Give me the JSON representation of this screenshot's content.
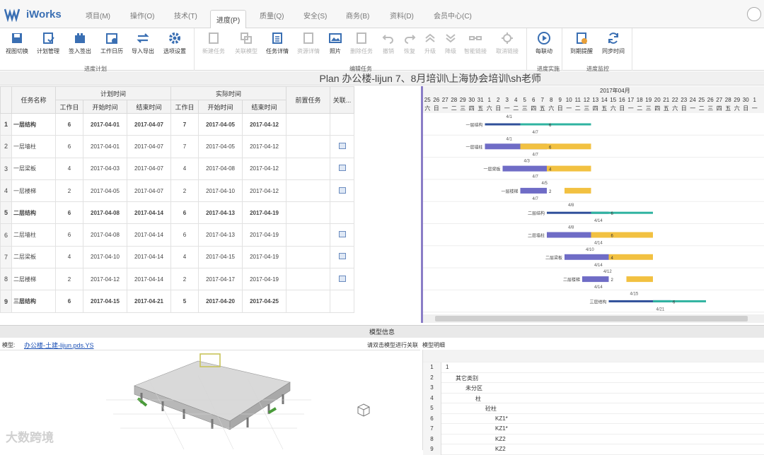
{
  "app": {
    "title": "iWorks"
  },
  "nav": {
    "tabs": [
      "项目(M)",
      "操作(O)",
      "技术(T)",
      "进度(P)",
      "质量(Q)",
      "安全(S)",
      "商务(B)",
      "资料(D)",
      "会员中心(C)"
    ],
    "active": "进度(P)"
  },
  "ribbon": {
    "tools": [
      "视图切换",
      "计划管理",
      "签入签出",
      "工作日历",
      "导入导出",
      "选项设置",
      "新建任务",
      "关联模型",
      "任务详情",
      "资源详情",
      "照片",
      "删除任务",
      "撤销",
      "恢复",
      "升级",
      "降级",
      "智能链接",
      "取消链接",
      "每联动",
      "到期提醒",
      "同步时间"
    ],
    "groups": [
      "进度计划",
      "编辑任务",
      "进度实施",
      "进度监控"
    ]
  },
  "plan": {
    "title": "Plan 办公楼-lijun 7、8月培训\\上海协会培训\\sh老师"
  },
  "grid": {
    "headers": {
      "task_name": "任务名称",
      "planned": "计划时间",
      "actual": "实际时间",
      "workdays": "工作日",
      "start": "开始时间",
      "end": "结束时间",
      "predecessor": "前置任务",
      "related": "关联..."
    },
    "rows": [
      {
        "n": "1",
        "name": "一层结构",
        "pw": "6",
        "ps": "2017-04-01",
        "pe": "2017-04-07",
        "aw": "7",
        "as": "2017-04-05",
        "ae": "2017-04-12",
        "bold": true
      },
      {
        "n": "2",
        "name": "一层墙柱",
        "pw": "6",
        "ps": "2017-04-01",
        "pe": "2017-04-07",
        "aw": "7",
        "as": "2017-04-05",
        "ae": "2017-04-12",
        "bold": false
      },
      {
        "n": "3",
        "name": "一层梁板",
        "pw": "4",
        "ps": "2017-04-03",
        "pe": "2017-04-07",
        "aw": "4",
        "as": "2017-04-08",
        "ae": "2017-04-12",
        "bold": false
      },
      {
        "n": "4",
        "name": "一层楼梯",
        "pw": "2",
        "ps": "2017-04-05",
        "pe": "2017-04-07",
        "aw": "2",
        "as": "2017-04-10",
        "ae": "2017-04-12",
        "bold": false
      },
      {
        "n": "5",
        "name": "二层结构",
        "pw": "6",
        "ps": "2017-04-08",
        "pe": "2017-04-14",
        "aw": "6",
        "as": "2017-04-13",
        "ae": "2017-04-19",
        "bold": true
      },
      {
        "n": "6",
        "name": "二层墙柱",
        "pw": "6",
        "ps": "2017-04-08",
        "pe": "2017-04-14",
        "aw": "6",
        "as": "2017-04-13",
        "ae": "2017-04-19",
        "bold": false
      },
      {
        "n": "7",
        "name": "二层梁板",
        "pw": "4",
        "ps": "2017-04-10",
        "pe": "2017-04-14",
        "aw": "4",
        "as": "2017-04-15",
        "ae": "2017-04-19",
        "bold": false
      },
      {
        "n": "8",
        "name": "二层楼梯",
        "pw": "2",
        "ps": "2017-04-12",
        "pe": "2017-04-14",
        "aw": "2",
        "as": "2017-04-17",
        "ae": "2017-04-19",
        "bold": false
      },
      {
        "n": "9",
        "name": "三层结构",
        "pw": "6",
        "ps": "2017-04-15",
        "pe": "2017-04-21",
        "aw": "5",
        "as": "2017-04-20",
        "ae": "2017-04-25",
        "bold": true
      }
    ]
  },
  "gantt": {
    "month": "2017年04月",
    "days": [
      "25",
      "26",
      "27",
      "28",
      "29",
      "30",
      "31",
      "1",
      "2",
      "3",
      "4",
      "5",
      "6",
      "7",
      "8",
      "9",
      "10",
      "11",
      "12",
      "13",
      "14",
      "15",
      "16",
      "17",
      "18",
      "19",
      "20",
      "21",
      "22",
      "23",
      "24",
      "25",
      "26",
      "27",
      "28",
      "29",
      "30",
      "1"
    ],
    "weekdays": [
      "六",
      "日",
      "一",
      "二",
      "三",
      "四",
      "五",
      "六",
      "日",
      "一",
      "二",
      "三",
      "四",
      "五",
      "六",
      "日",
      "一",
      "二",
      "三",
      "四",
      "五",
      "六",
      "日",
      "一",
      "二",
      "三",
      "四",
      "五",
      "六",
      "日",
      "一",
      "二",
      "三",
      "四",
      "五",
      "六",
      "日",
      "一"
    ]
  },
  "model": {
    "panel_title": "模型信息",
    "label": "模型:",
    "file": "办公楼-土建-lijun.pds.YS",
    "hint": "请双击模型进行关联",
    "detail_label": "模型明细",
    "tree": [
      {
        "n": "1",
        "t": "1",
        "lvl": 0
      },
      {
        "n": "2",
        "t": "其它类别",
        "lvl": 1
      },
      {
        "n": "3",
        "t": "未分区",
        "lvl": 2
      },
      {
        "n": "4",
        "t": "柱",
        "lvl": 3
      },
      {
        "n": "5",
        "t": "砼柱",
        "lvl": 4
      },
      {
        "n": "6",
        "t": "KZ1*",
        "lvl": 5
      },
      {
        "n": "7",
        "t": "KZ1*",
        "lvl": 5
      },
      {
        "n": "8",
        "t": "KZ2",
        "lvl": 5
      },
      {
        "n": "9",
        "t": "KZ2",
        "lvl": 5
      }
    ]
  },
  "watermark": "大数跨境",
  "colors": {
    "planned": "#6f6cc6",
    "actual": "#f2c141",
    "summary_plan": "#2f4f9a",
    "summary_actual": "#2fb3a0"
  }
}
